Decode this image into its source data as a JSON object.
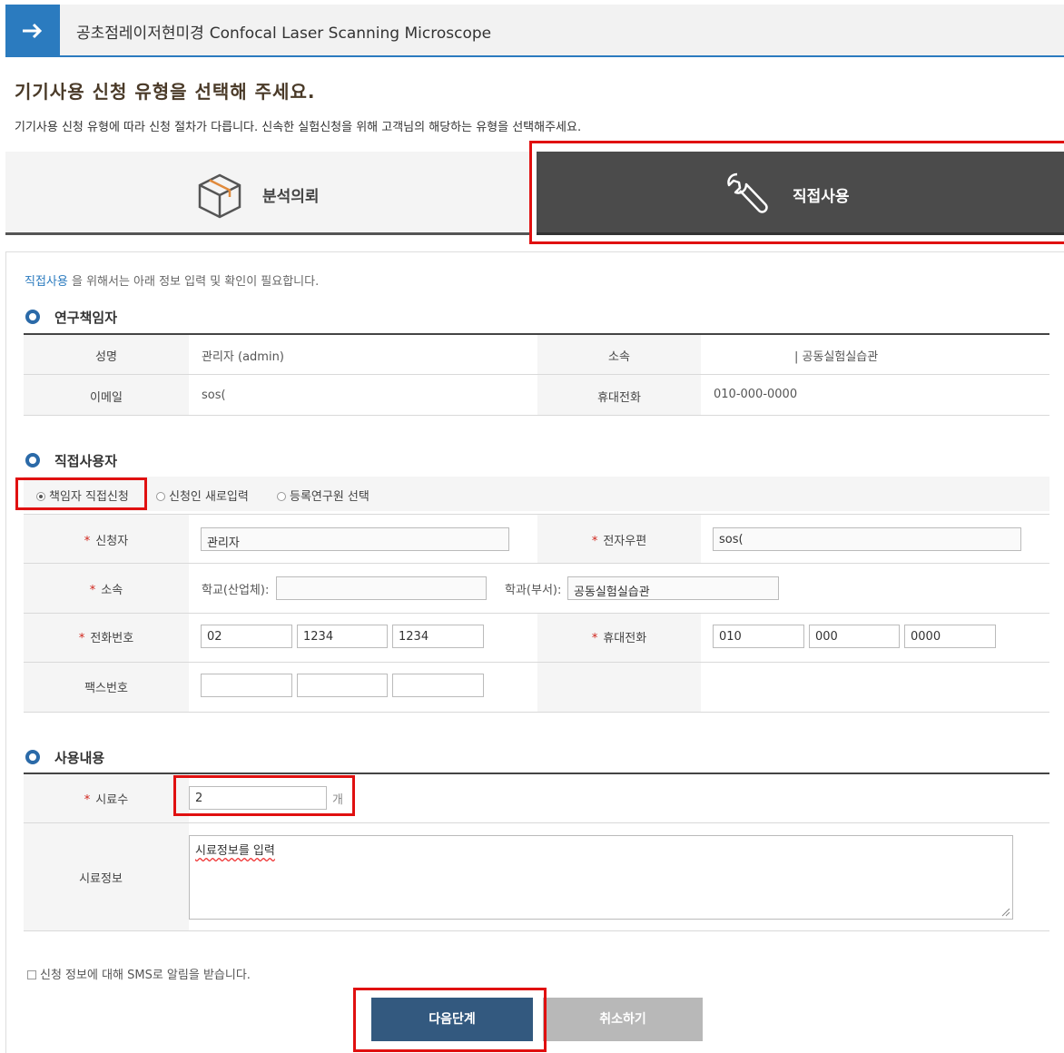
{
  "header": {
    "title_ko": "공초점레이저현미경",
    "title_en": "Confocal Laser Scanning Microscope",
    "arrow_icon": "arrow-right-icon"
  },
  "heading": "기기사용 신청 유형을 선택해 주세요.",
  "subheading": "기기사용 신청 유형에 따라 신청 절차가 다릅니다. 신속한 실험신청을 위해 고객님의 해당하는 유형을 선택해주세요.",
  "tabs": {
    "analysis": {
      "label": "분석의뢰",
      "icon": "box-icon"
    },
    "direct": {
      "label": "직접사용",
      "icon": "wrench-icon",
      "selected": true
    }
  },
  "notice": {
    "highlight": "직접사용",
    "text": " 을 위해서는 아래 정보 입력 및 확인이 필요합니다."
  },
  "pi": {
    "title": "연구책임자",
    "name_label": "성명",
    "name_value": "관리자 (admin)",
    "affil_label": "소속",
    "affil_value": "| 공동실험실습관",
    "email_label": "이메일",
    "email_value": "sos(",
    "mobile_label": "휴대전화",
    "mobile_value": "010-000-0000"
  },
  "user": {
    "title": "직접사용자",
    "radio_options": [
      "책임자 직접신청",
      "신청인 새로입력",
      "등록연구원 선택"
    ],
    "radio_selected": "책임자 직접신청",
    "required_mark": "*",
    "applicant_label": "신청자",
    "applicant_value": "관리자",
    "email_label": "전자우편",
    "email_value": "sos(",
    "affil_label": "소속",
    "school_label": "학교(산업체):",
    "school_value": "",
    "dept_label": "학과(부서):",
    "dept_value": "공동실험실습관",
    "phone_label": "전화번호",
    "phone": [
      "02",
      "1234",
      "1234"
    ],
    "mobile_label": "휴대전화",
    "mobile": [
      "010",
      "000",
      "0000"
    ],
    "fax_label": "팩스번호",
    "fax": [
      "",
      "",
      ""
    ]
  },
  "usage": {
    "title": "사용내용",
    "sample_count_label": "시료수",
    "sample_count_value": "2",
    "sample_count_unit": "개",
    "sample_info_label": "시료정보",
    "sample_info_value": "시료정보를 입력"
  },
  "sms_label": "신청 정보에 대해 SMS로 알림을 받습니다.",
  "buttons": {
    "next": "다음단계",
    "cancel": "취소하기"
  },
  "colors": {
    "accent": "#2b7bbf",
    "highlight_box": "#e01010",
    "next_button": "#33597f",
    "selected_tab": "#4b4b4b"
  }
}
